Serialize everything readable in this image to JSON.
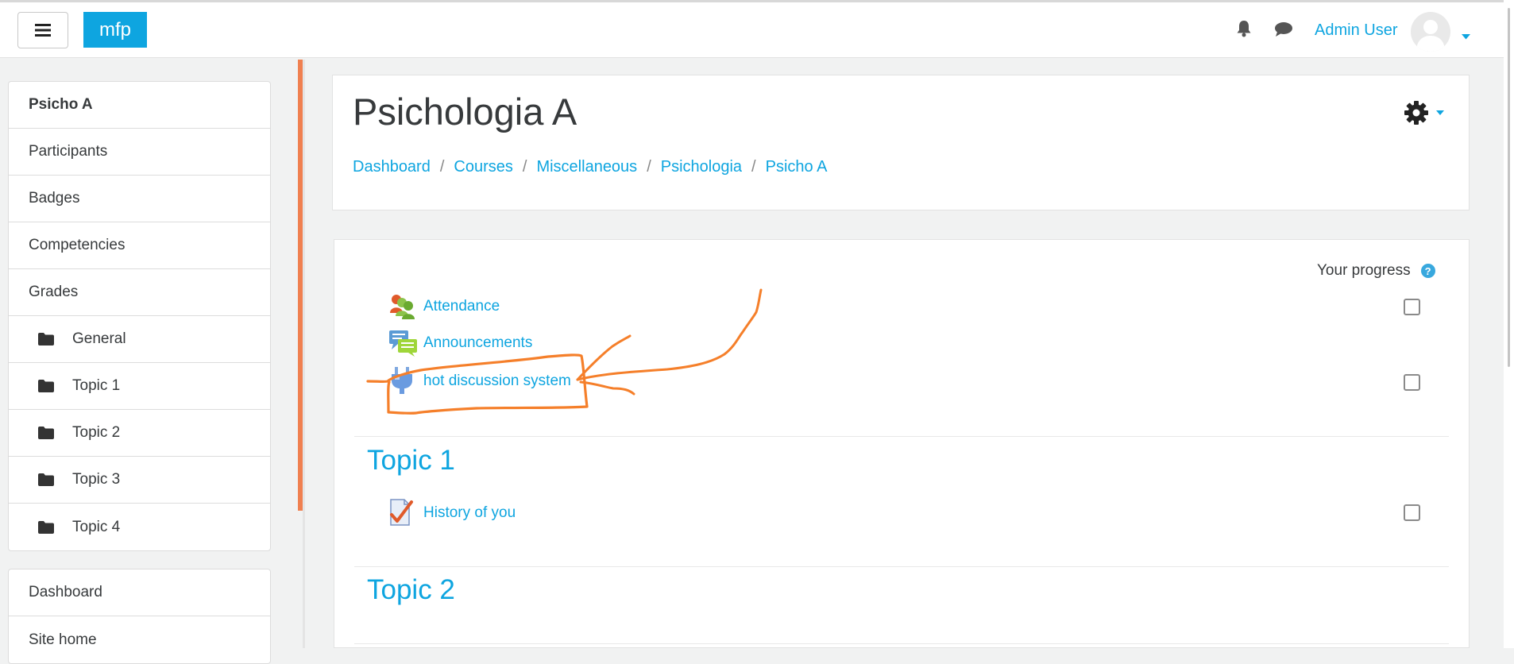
{
  "navbar": {
    "brand": "mfp",
    "user_name": "Admin User"
  },
  "drawer": {
    "course_nav": [
      {
        "label": "Psicho A",
        "bold": true
      },
      {
        "label": "Participants"
      },
      {
        "label": "Badges"
      },
      {
        "label": "Competencies"
      },
      {
        "label": "Grades"
      },
      {
        "label": "General",
        "icon": "folder-icon"
      },
      {
        "label": "Topic 1",
        "icon": "folder-icon"
      },
      {
        "label": "Topic 2",
        "icon": "folder-icon"
      },
      {
        "label": "Topic 3",
        "icon": "folder-icon"
      },
      {
        "label": "Topic 4",
        "icon": "folder-icon"
      }
    ],
    "site_nav": [
      {
        "label": "Dashboard"
      },
      {
        "label": "Site home"
      }
    ]
  },
  "header": {
    "title": "Psichologia A",
    "breadcrumb": [
      "Dashboard",
      "Courses",
      "Miscellaneous",
      "Psichologia",
      "Psicho A"
    ]
  },
  "course": {
    "progress_label": "Your progress",
    "general_activities": [
      {
        "label": "Attendance",
        "icon": "attendance-icon",
        "has_checkbox": true,
        "checked": false
      },
      {
        "label": "Announcements",
        "icon": "forum-icon",
        "has_checkbox": false
      },
      {
        "label": "hot discussion system",
        "icon": "plugin-icon",
        "has_checkbox": true,
        "checked": false
      }
    ],
    "sections": [
      {
        "title": "Topic 1",
        "activities": [
          {
            "label": "History of you",
            "icon": "assignment-icon",
            "has_checkbox": true,
            "checked": false
          }
        ]
      },
      {
        "title": "Topic 2",
        "activities": []
      }
    ]
  },
  "colors": {
    "accent": "#0ea5e0",
    "annotation": "#f57f2a",
    "drawer_edge": "#f08050"
  }
}
